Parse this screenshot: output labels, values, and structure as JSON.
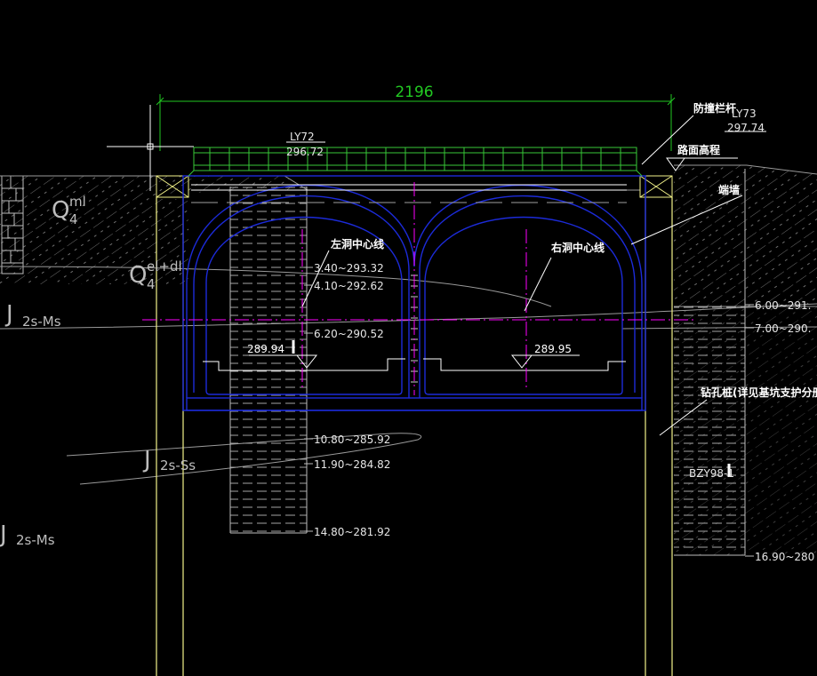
{
  "dimension": {
    "span": "2196"
  },
  "survey_points": [
    {
      "id": "LY72",
      "value": "296.72"
    },
    {
      "id": "LY73",
      "value": "297.74"
    }
  ],
  "callouts": {
    "guardrail": "防撞栏杆",
    "road_elevation": "路面高程",
    "end_wall": "端墙",
    "left_centerline": "左洞中心线",
    "right_centerline": "右洞中心线",
    "bored_pile": "钻孔桩(详见基坑支护分册)",
    "borehole": "BZY98-1"
  },
  "elevations": {
    "left_floor": "289.94",
    "right_floor": "289.95"
  },
  "borehole_left": [
    "3.40~293.32",
    "4.10~292.62",
    "6.20~290.52",
    "10.80~285.92",
    "11.90~284.82",
    "14.80~281.92"
  ],
  "borehole_right": [
    "6.00~291.",
    "7.00~290.",
    "16.90~280"
  ],
  "strata": [
    {
      "main": "Q",
      "sup": "ml",
      "sub": "4"
    },
    {
      "main": "Q",
      "sup": "el+dl",
      "sub": "4"
    },
    {
      "main": "J",
      "sub": "2s-Ms"
    },
    {
      "main": "J",
      "sub": "2s-Ss"
    },
    {
      "main": "J",
      "sub": "2s-Ms"
    }
  ],
  "colors": {
    "background": "#000000",
    "tunnel": "#1c2bd9",
    "dimension": "#22c922",
    "guardrail": "#37c837",
    "pile": "#f2f28a",
    "centerline": "#ff00ff",
    "ground": "#9a9a9a",
    "text": "#ffffff"
  }
}
